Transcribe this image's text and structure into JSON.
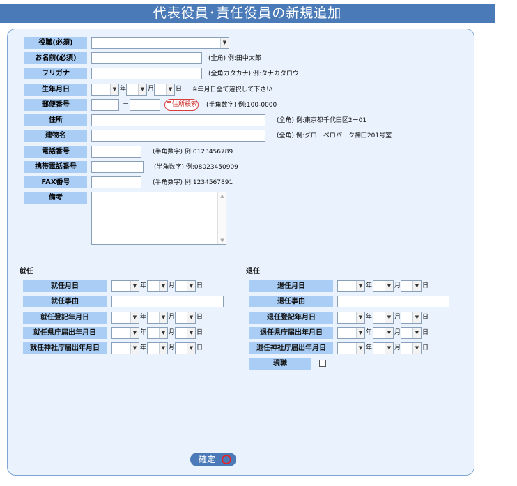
{
  "page_title": "代表役員･責任役員の新規追加",
  "fields": {
    "role_label": "役職(必須)",
    "name_label": "お名前(必須)",
    "name_hint": "(全角) 例:田中太郎",
    "kana_label": "フリガナ",
    "kana_hint": "(全角カタカナ) 例:タナカタロウ",
    "birth_label": "生年月日",
    "birth_hint": "※年月日全て選択して下さい",
    "zip_label": "郵便番号",
    "zip_dash": "－",
    "zip_button": "〒住所検索",
    "zip_hint": "(半角数字) 例:100-0000",
    "address_label": "住所",
    "address_hint": "(全角) 例:東京都千代田区2ー01",
    "building_label": "建物名",
    "building_hint": "(全角) 例:グローベロパーク神田201号室",
    "phone_label": "電話番号",
    "phone_hint": "(半角数字) 例:0123456789",
    "mobile_label": "携帯電話番号",
    "mobile_hint": "(半角数字) 例:08023450909",
    "fax_label": "FAX番号",
    "fax_hint": "(半角数字) 例:1234567891",
    "note_label": "備考"
  },
  "units": {
    "year": "年",
    "month": "月",
    "day": "日"
  },
  "appointment": {
    "section_title": "就任",
    "date_label": "就任月日",
    "reason_label": "就任事由",
    "registration_label": "就任登記年月日",
    "prefecture_label": "就任県庁届出年月日",
    "shrine_label": "就任神社庁届出年月日"
  },
  "retirement": {
    "section_title": "退任",
    "date_label": "退任月日",
    "reason_label": "退任事由",
    "registration_label": "退任登記年月日",
    "prefecture_label": "退任県庁届出年月日",
    "shrine_label": "退任神社庁届出年月日",
    "current_label": "現職"
  },
  "confirm_label": "確定"
}
